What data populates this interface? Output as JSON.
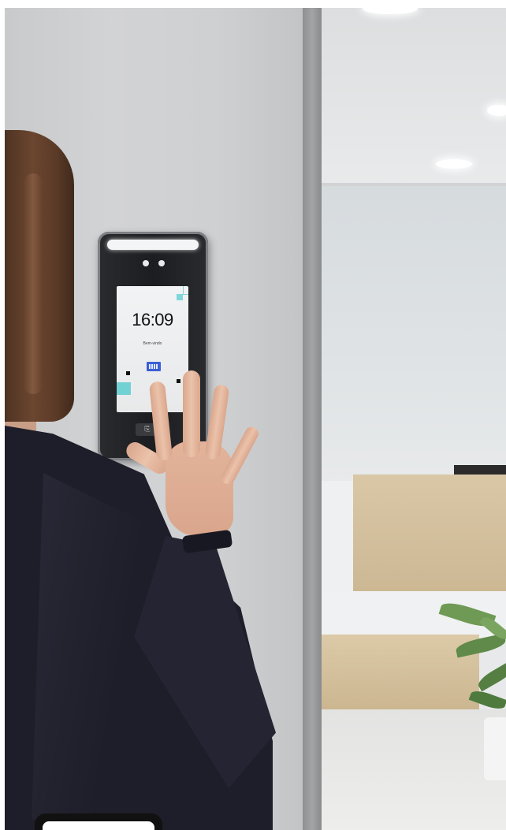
{
  "device": {
    "screen_time": "16:09",
    "screen_subtitle": "Bem-vindo"
  },
  "colors": {
    "wall": "#cfd0d2",
    "device_body": "#1c1d20",
    "screen": "#f2f3f4",
    "accent_teal": "#72d1d3",
    "accent_blue": "#3b5fd6",
    "jacket": "#1e1e2a",
    "hair": "#5a3a27",
    "desk_wood": "#d9c7a6"
  },
  "icons": {
    "card_reader": "contactless-card-icon"
  }
}
